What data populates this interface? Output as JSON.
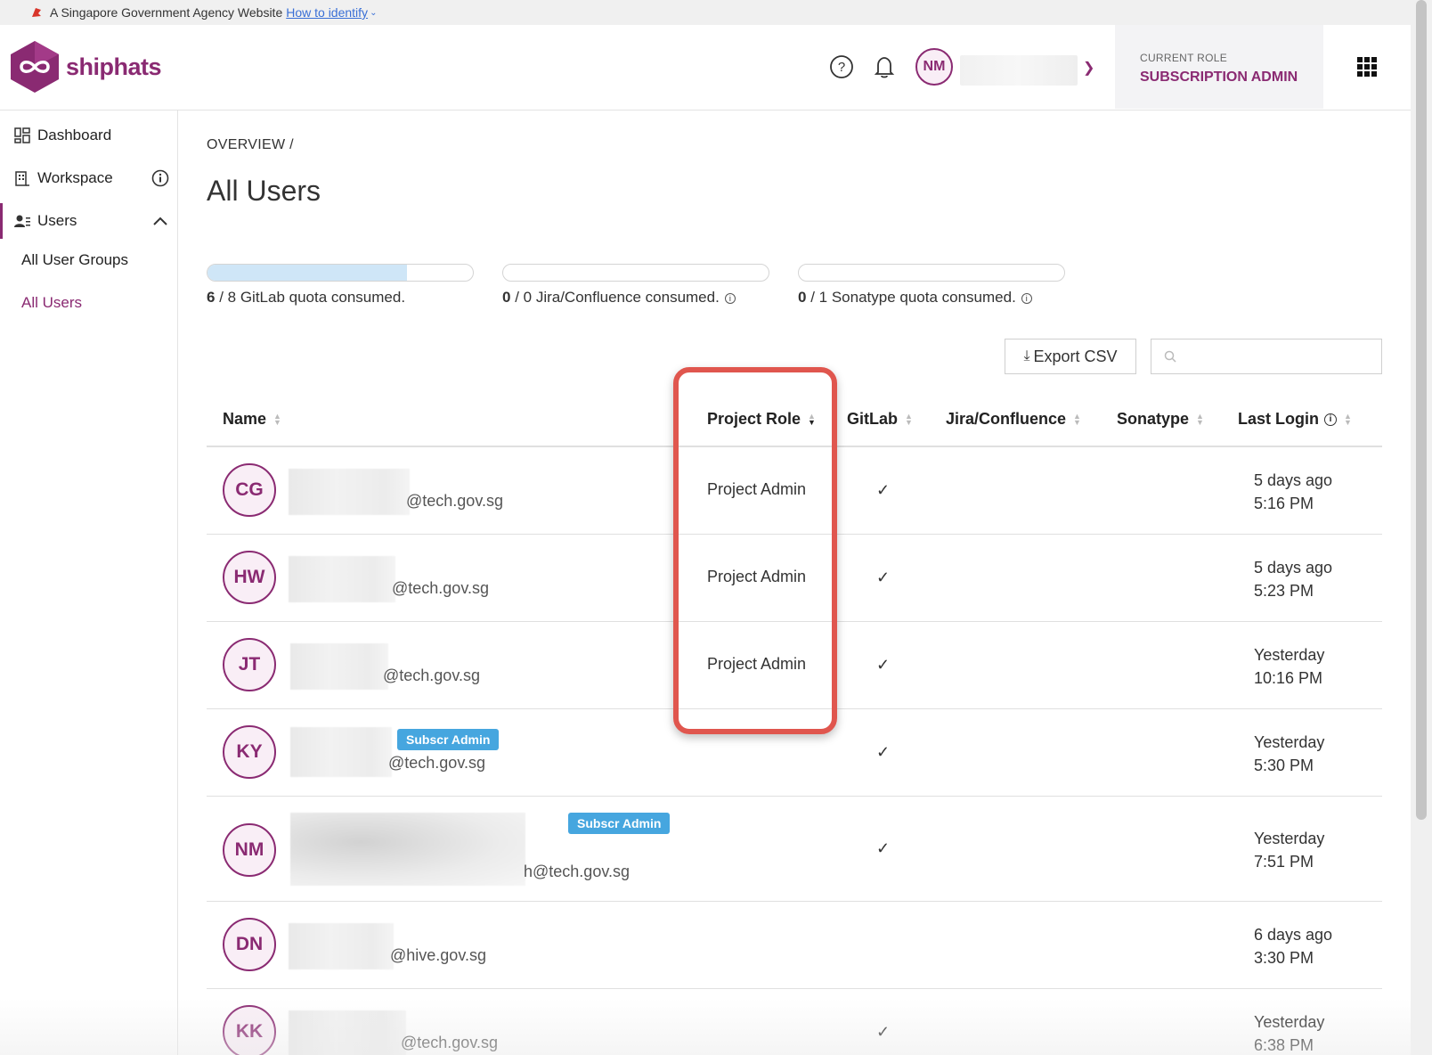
{
  "gov_banner": {
    "text": "A Singapore Government Agency Website",
    "link": "How to identify"
  },
  "header": {
    "logo_text": "shiphats",
    "user_initials": "NM",
    "current_role_label": "CURRENT ROLE",
    "current_role_value": "SUBSCRIPTION ADMIN"
  },
  "sidebar": {
    "dashboard": "Dashboard",
    "workspace": "Workspace",
    "users": "Users",
    "sub_items": [
      "All User Groups",
      "All Users"
    ]
  },
  "main": {
    "breadcrumb": "OVERVIEW   /",
    "title": "All Users",
    "quotas": [
      {
        "used": "6",
        "rest": " / 8 GitLab quota consumed.",
        "fill": 0.75,
        "info": false
      },
      {
        "used": "0",
        "rest": " / 0 Jira/Confluence consumed.",
        "fill": 0,
        "info": true
      },
      {
        "used": "0",
        "rest": " / 1 Sonatype quota consumed.",
        "fill": 0,
        "info": true
      }
    ],
    "export_label": "Export CSV",
    "search_placeholder": ""
  },
  "table": {
    "columns": [
      "Name",
      "Project Role",
      "GitLab",
      "Jira/Confluence",
      "Sonatype",
      "Last Login"
    ],
    "rows": [
      {
        "initials": "CG",
        "email": "@tech.gov.sg",
        "badge": "",
        "project_role": "Project Admin",
        "gitlab": "✓",
        "last_login_1": "5 days ago",
        "last_login_2": "5:16 PM"
      },
      {
        "initials": "HW",
        "email": "@tech.gov.sg",
        "badge": "",
        "project_role": "Project Admin",
        "gitlab": "✓",
        "last_login_1": "5 days ago",
        "last_login_2": "5:23 PM"
      },
      {
        "initials": "JT",
        "email": "@tech.gov.sg",
        "badge": "",
        "project_role": "Project Admin",
        "gitlab": "✓",
        "last_login_1": "Yesterday",
        "last_login_2": "10:16 PM"
      },
      {
        "initials": "KY",
        "email": "@tech.gov.sg",
        "badge": "Subscr Admin",
        "project_role": "",
        "gitlab": "✓",
        "last_login_1": "Yesterday",
        "last_login_2": "5:30 PM"
      },
      {
        "initials": "NM",
        "email": "h@tech.gov.sg",
        "badge": "Subscr Admin",
        "project_role": "",
        "gitlab": "✓",
        "last_login_1": "Yesterday",
        "last_login_2": "7:51 PM"
      },
      {
        "initials": "DN",
        "email": "@hive.gov.sg",
        "badge": "",
        "project_role": "",
        "gitlab": "",
        "last_login_1": "6 days ago",
        "last_login_2": "3:30 PM"
      },
      {
        "initials": "KK",
        "email": "@tech.gov.sg",
        "badge": "",
        "project_role": "",
        "gitlab": "✓",
        "last_login_1": "Yesterday",
        "last_login_2": "6:38 PM"
      }
    ]
  },
  "colors": {
    "brand": "#8a2a72",
    "badge": "#46a6df",
    "highlight": "#e0564e",
    "quota_fill": "#cfe6f7"
  }
}
